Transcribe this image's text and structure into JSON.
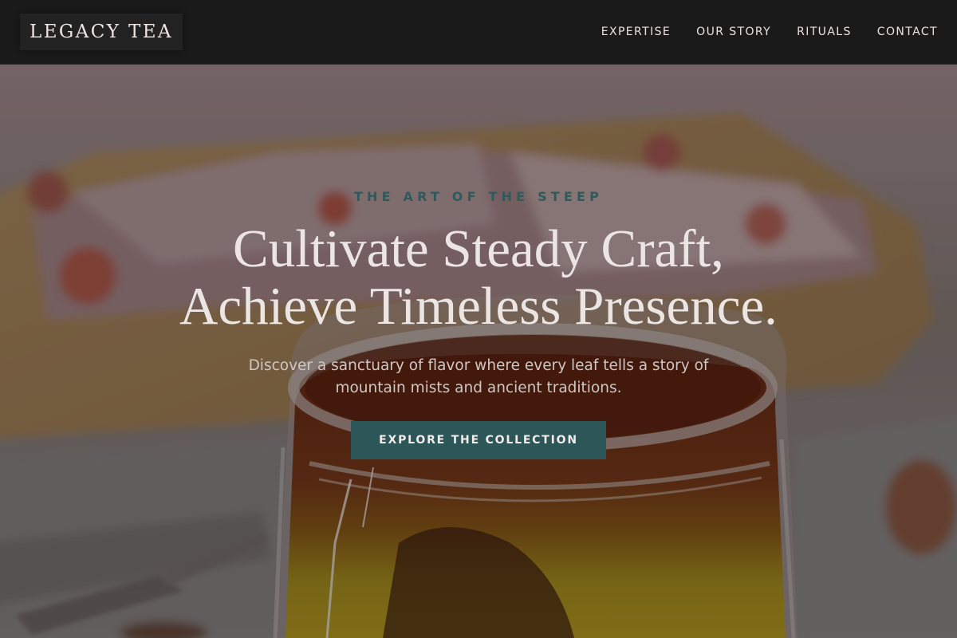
{
  "nav": {
    "brand": "LEGACY TEA",
    "links": [
      "EXPERTISE",
      "OUR STORY",
      "RITUALS",
      "CONTACT"
    ]
  },
  "hero": {
    "eyebrow": "THE ART OF THE STEEP",
    "headline_line1": "Cultivate Steady Craft,",
    "headline_line2": "Achieve Timeless Presence.",
    "subtext": "Discover a sanctuary of flavor where every leaf tells a story of mountain mists and ancient traditions.",
    "cta_label": "EXPLORE THE COLLECTION"
  },
  "colors": {
    "nav_background": "#1b1a1b",
    "accent_teal": "#2d5659",
    "eyebrow_teal": "#2f5a5c",
    "headline_text": "#ebe6e4"
  }
}
